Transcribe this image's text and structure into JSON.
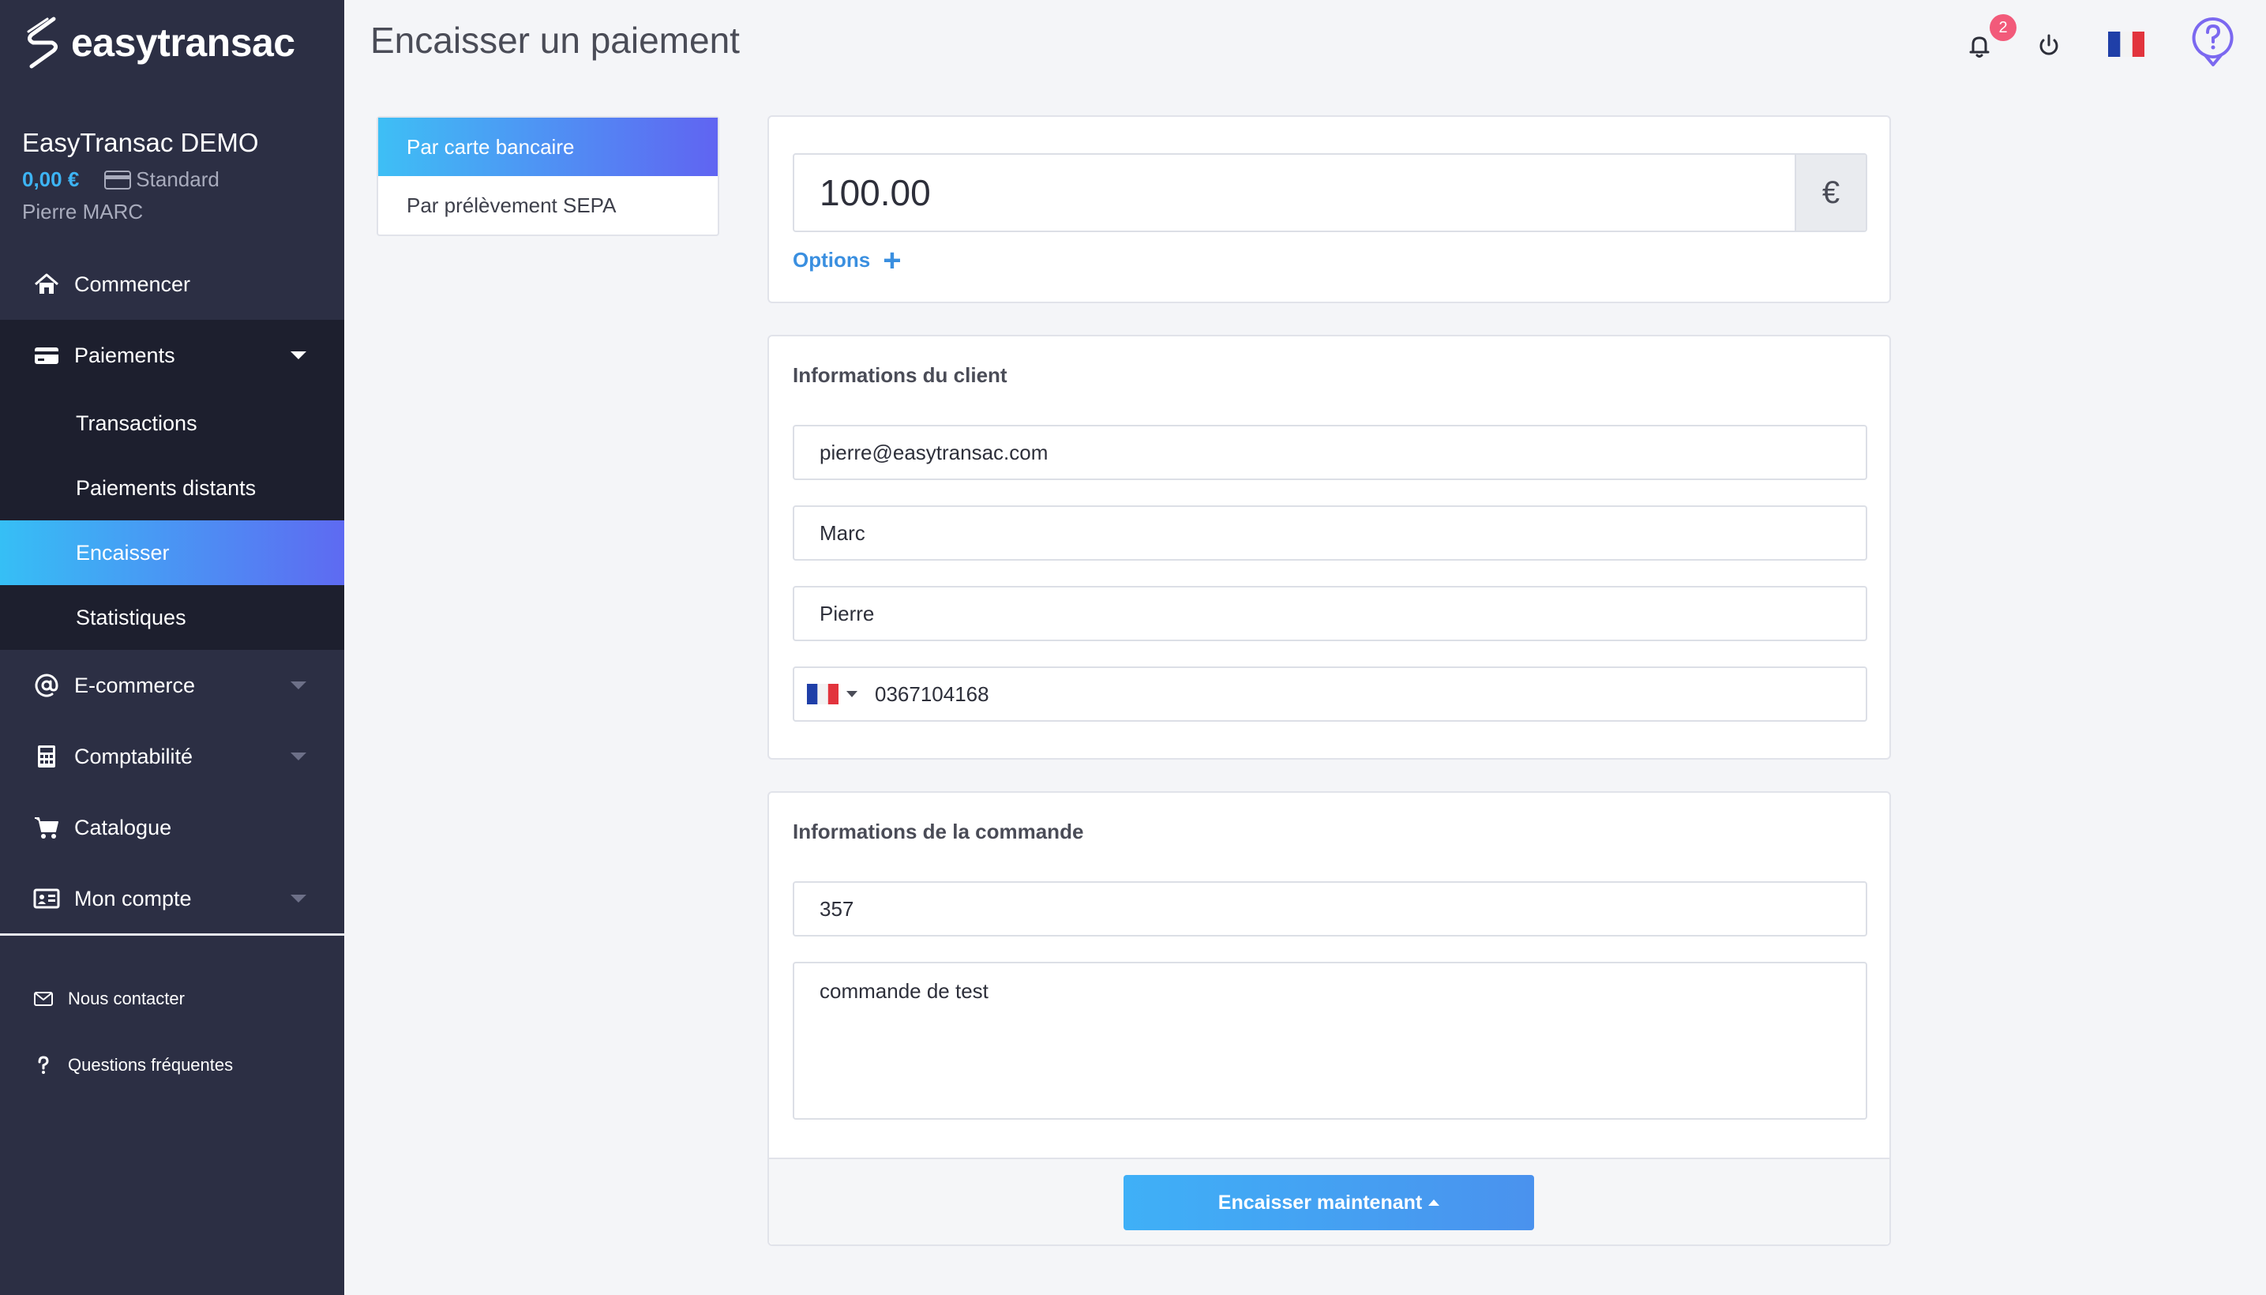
{
  "brand": {
    "name": "easytransac"
  },
  "account": {
    "name": "EasyTransac DEMO",
    "balance": "0,00 €",
    "plan": "Standard",
    "user": "Pierre MARC"
  },
  "sidebar": {
    "items": [
      {
        "label": "Commencer",
        "icon": "home-icon"
      },
      {
        "label": "Paiements",
        "icon": "credit-card-icon"
      },
      {
        "label": "E-commerce",
        "icon": "at-icon"
      },
      {
        "label": "Comptabilité",
        "icon": "calculator-icon"
      },
      {
        "label": "Catalogue",
        "icon": "cart-icon"
      },
      {
        "label": "Mon compte",
        "icon": "id-card-icon"
      }
    ],
    "sub_items": [
      "Transactions",
      "Paiements distants",
      "Encaisser",
      "Statistiques"
    ],
    "footer": [
      {
        "label": "Nous contacter",
        "icon": "envelope-icon"
      },
      {
        "label": "Questions fréquentes",
        "icon": "question-icon"
      }
    ]
  },
  "header": {
    "title": "Encaisser un paiement",
    "notification_count": "2"
  },
  "tabs": [
    "Par carte bancaire",
    "Par prélèvement SEPA"
  ],
  "payment": {
    "amount": "100.00",
    "currency": "€",
    "options_label": "Options",
    "options_plus": "+"
  },
  "client": {
    "title": "Informations du client",
    "email": "pierre@easytransac.com",
    "lastname": "Marc",
    "firstname": "Pierre",
    "phone": "0367104168"
  },
  "order": {
    "title": "Informations de la commande",
    "number": "357",
    "description": "commande de test",
    "submit_label": "Encaisser maintenant"
  },
  "colors": {
    "sidebar": "#2c2f44",
    "accent": "#3db4f4",
    "active_gradient_end": "#5e6af2",
    "badge": "#f25a7a"
  }
}
